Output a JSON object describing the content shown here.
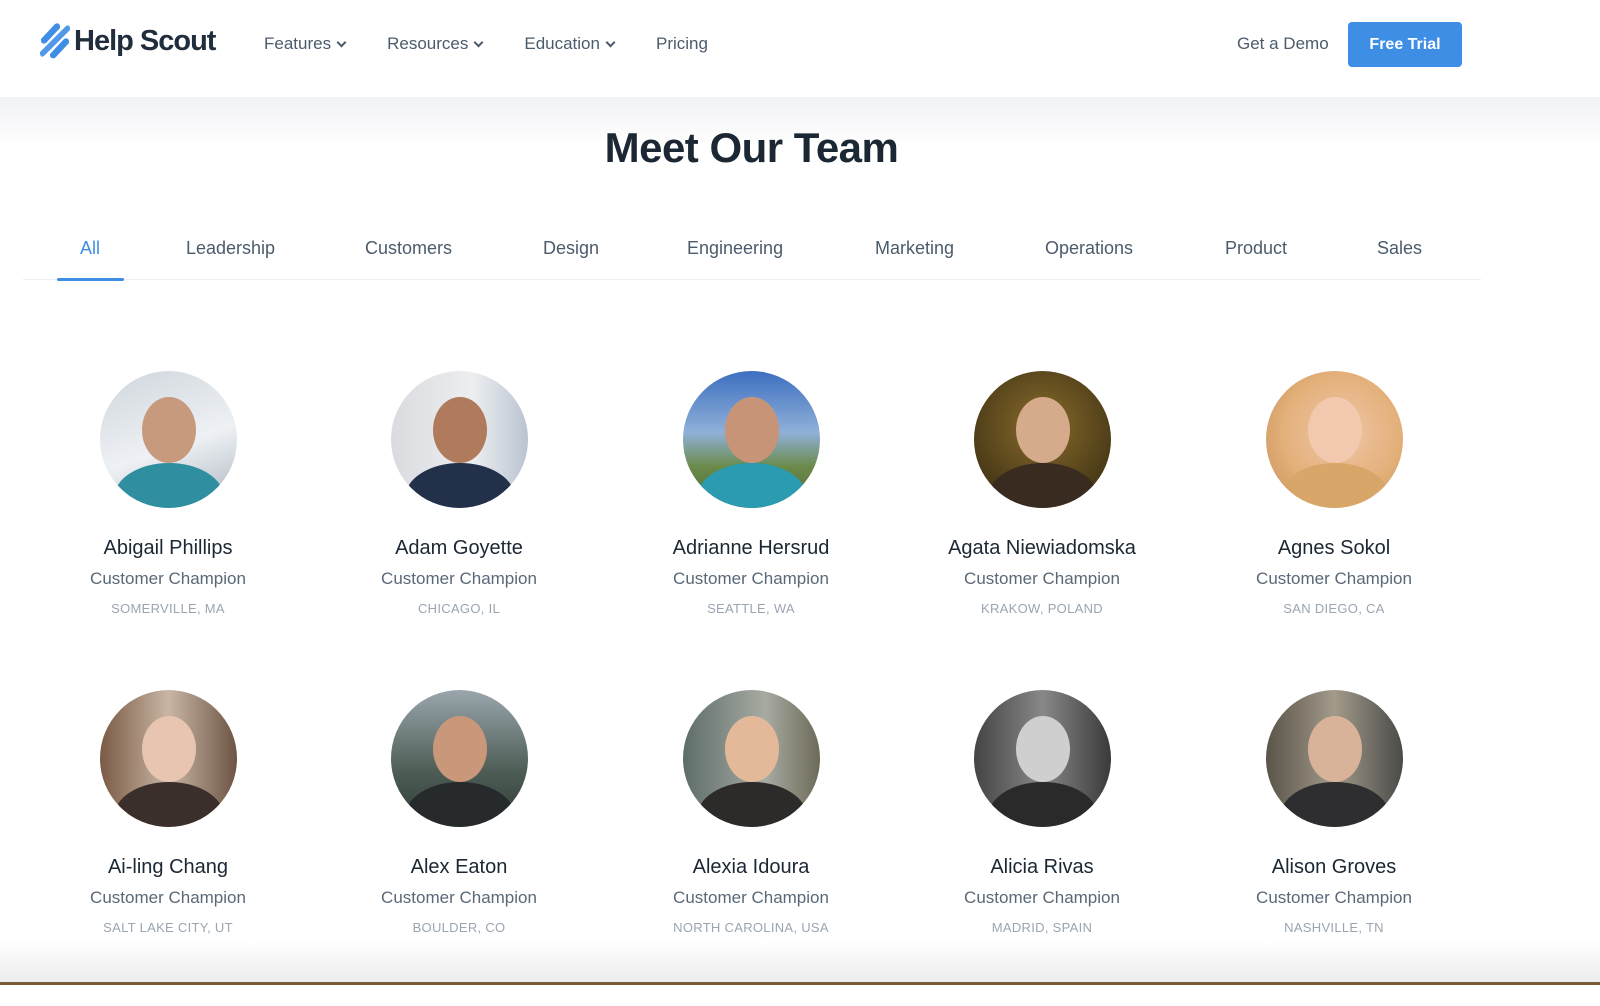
{
  "brand": {
    "name": "Help Scout",
    "accent_color": "#3e8ee6",
    "logo_icon": "help-scout-stripes-icon"
  },
  "nav": {
    "items": [
      {
        "label": "Features",
        "has_dropdown": true
      },
      {
        "label": "Resources",
        "has_dropdown": true
      },
      {
        "label": "Education",
        "has_dropdown": true
      },
      {
        "label": "Pricing",
        "has_dropdown": false
      }
    ],
    "demo_label": "Get a Demo",
    "trial_label": "Free Trial"
  },
  "page": {
    "title": "Meet Our Team"
  },
  "tabs": {
    "active": "All",
    "items": [
      "All",
      "Leadership",
      "Customers",
      "Design",
      "Engineering",
      "Marketing",
      "Operations",
      "Product",
      "Sales"
    ]
  },
  "team": [
    {
      "name": "Abigail Phillips",
      "role": "Customer Champion",
      "location": "Somerville, MA"
    },
    {
      "name": "Adam Goyette",
      "role": "Customer Champion",
      "location": "Chicago, IL"
    },
    {
      "name": "Adrianne Hersrud",
      "role": "Customer Champion",
      "location": "Seattle, WA"
    },
    {
      "name": "Agata Niewiadomska",
      "role": "Customer Champion",
      "location": "Krakow, Poland"
    },
    {
      "name": "Agnes Sokol",
      "role": "Customer Champion",
      "location": "San Diego, CA"
    },
    {
      "name": "Ai-ling Chang",
      "role": "Customer Champion",
      "location": "Salt Lake City, UT"
    },
    {
      "name": "Alex Eaton",
      "role": "Customer Champion",
      "location": "Boulder, CO"
    },
    {
      "name": "Alexia Idoura",
      "role": "Customer Champion",
      "location": "North Carolina, USA"
    },
    {
      "name": "Alicia Rivas",
      "role": "Customer Champion",
      "location": "Madrid, Spain"
    },
    {
      "name": "Alison Groves",
      "role": "Customer Champion",
      "location": "Nashville, TN"
    }
  ]
}
